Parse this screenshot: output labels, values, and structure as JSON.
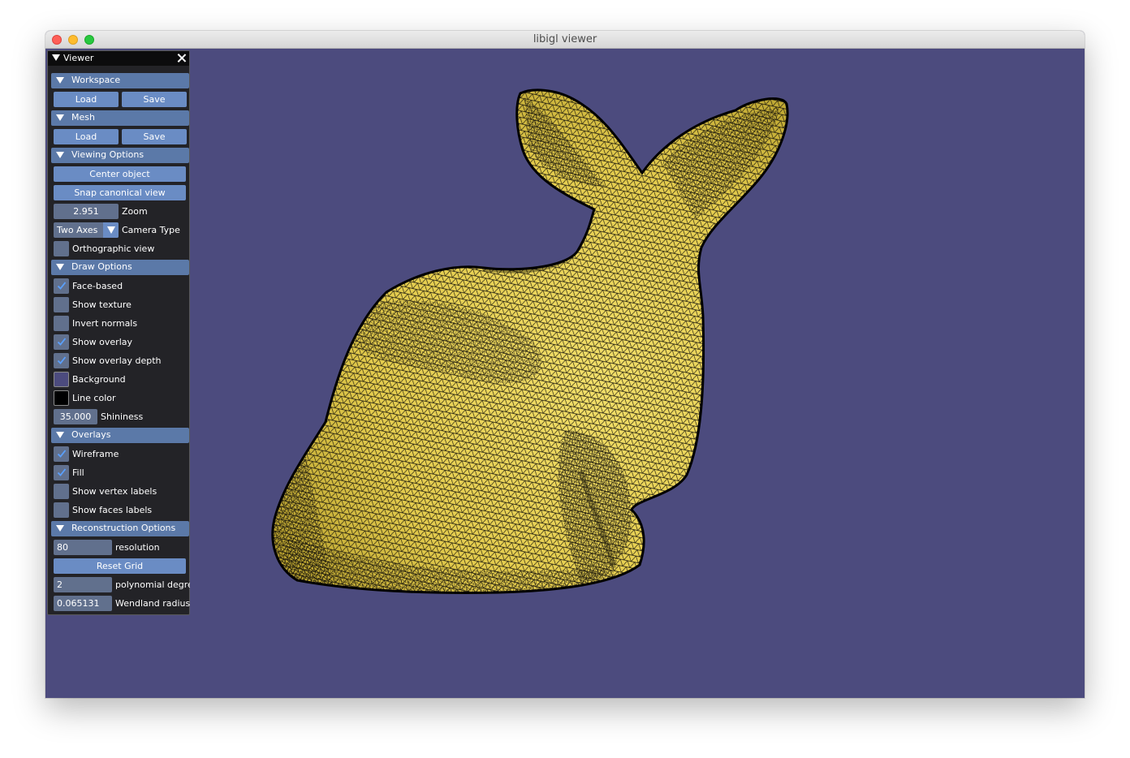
{
  "window": {
    "title": "libigl viewer"
  },
  "colors": {
    "viewport_background": "#4c4b7e",
    "mesh_fill": "#e8d24a",
    "wireframe": "#000000",
    "header": "#5b79a8",
    "button": "#6a8cc4",
    "line_color": "#000000"
  },
  "panel": {
    "title": "Viewer",
    "workspace": {
      "header": "Workspace",
      "load": "Load",
      "save": "Save"
    },
    "mesh": {
      "header": "Mesh",
      "load": "Load",
      "save": "Save"
    },
    "viewing": {
      "header": "Viewing Options",
      "center_object": "Center object",
      "snap_canonical_view": "Snap canonical view",
      "zoom_value": "2.951",
      "zoom_label": "Zoom",
      "camera_type_value": "Two Axes",
      "camera_type_label": "Camera Type",
      "orthographic_label": "Orthographic view",
      "orthographic_checked": false
    },
    "draw": {
      "header": "Draw Options",
      "face_based": {
        "label": "Face-based",
        "checked": true
      },
      "show_texture": {
        "label": "Show texture",
        "checked": false
      },
      "invert_normals": {
        "label": "Invert normals",
        "checked": false
      },
      "show_overlay": {
        "label": "Show overlay",
        "checked": true
      },
      "show_overlay_depth": {
        "label": "Show overlay depth",
        "checked": true
      },
      "background": {
        "label": "Background",
        "color": "#4c4b7e"
      },
      "line_color": {
        "label": "Line color",
        "color": "#000000"
      },
      "shininess_value": "35.000",
      "shininess_label": "Shininess"
    },
    "overlays": {
      "header": "Overlays",
      "wireframe": {
        "label": "Wireframe",
        "checked": true
      },
      "fill": {
        "label": "Fill",
        "checked": true
      },
      "show_vertex_labels": {
        "label": "Show vertex labels",
        "checked": false
      },
      "show_faces_labels": {
        "label": "Show faces labels",
        "checked": false
      }
    },
    "reconstruction": {
      "header": "Reconstruction Options",
      "resolution_value": "80",
      "resolution_label": "resolution",
      "reset_grid": "Reset Grid",
      "polynomial_value": "2",
      "polynomial_label": "polynomial degree",
      "wendland_value": "0.065131",
      "wendland_label": "Wendland radius"
    }
  }
}
